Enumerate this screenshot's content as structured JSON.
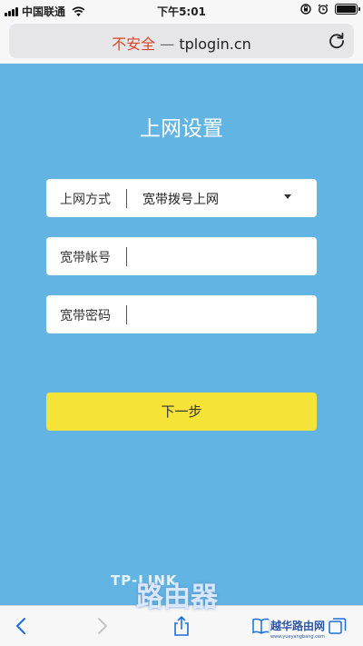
{
  "status_bar": {
    "carrier": "中国联通",
    "time": "下午5:01"
  },
  "browser": {
    "security_warning": "不安全",
    "separator": "—",
    "url": "tplogin.cn",
    "reload_icon": "reload-icon"
  },
  "page": {
    "title": "上网设置",
    "connection_type": {
      "label": "上网方式",
      "value": "宽带拨号上网"
    },
    "account": {
      "label": "宽带帐号",
      "value": ""
    },
    "password": {
      "label": "宽带密码",
      "value": ""
    },
    "next_label": "下一步",
    "brand": "TP-LINK"
  },
  "watermark": {
    "main": "路由器",
    "sub": "越华路由网",
    "url": "www.yueyangbang.com"
  },
  "toolbar": {
    "icons": [
      "back-icon",
      "forward-icon",
      "share-icon",
      "bookmarks-icon",
      "tabs-icon"
    ]
  },
  "colors": {
    "page_background": "#62b4e2",
    "next_button": "#f5e338",
    "security_warning": "#d9442a"
  }
}
